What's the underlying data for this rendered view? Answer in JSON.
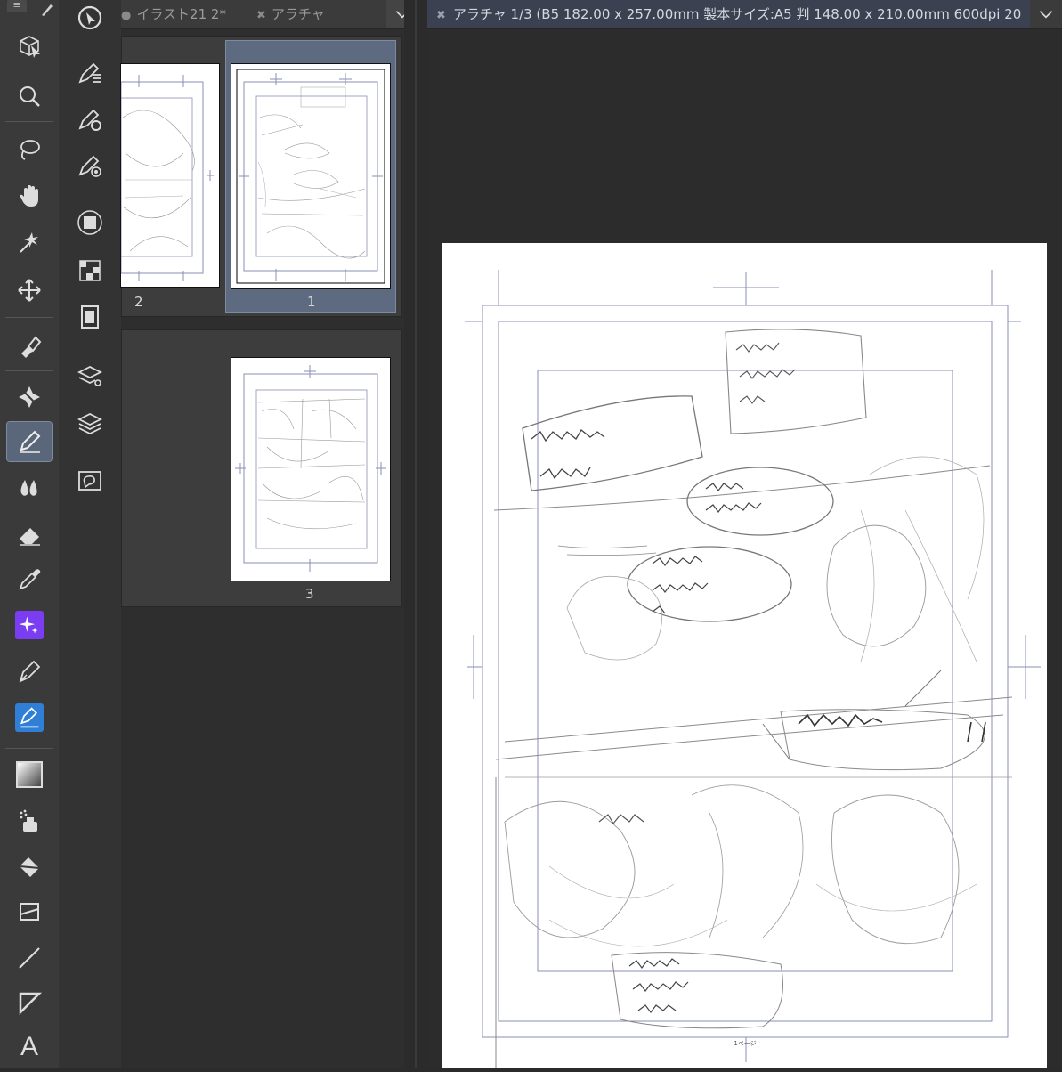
{
  "toolbar": {
    "menu_glyph": "≡",
    "tools": [
      {
        "name": "object-select-icon"
      },
      {
        "name": "zoom-icon"
      },
      {
        "name": "lasso-select-icon"
      },
      {
        "name": "hand-icon"
      },
      {
        "name": "magic-wand-icon"
      },
      {
        "name": "move-icon"
      },
      {
        "name": "eyedropper-rotate-icon"
      },
      {
        "name": "magic-wand-selection-icon"
      },
      {
        "name": "pen-icon",
        "active": true
      },
      {
        "name": "blend-icon"
      },
      {
        "name": "eraser-icon"
      },
      {
        "name": "eyedropper-icon"
      },
      {
        "name": "ai-sparkle-icon"
      },
      {
        "name": "fountain-pen-icon"
      },
      {
        "name": "fill-pen-icon"
      },
      {
        "name": "gradient-icon"
      },
      {
        "name": "airbrush-icon"
      },
      {
        "name": "paint-bucket-icon"
      },
      {
        "name": "frame-border-icon"
      },
      {
        "name": "line-icon"
      },
      {
        "name": "ruler-triangle-icon"
      },
      {
        "name": "text-icon",
        "label": "A"
      }
    ]
  },
  "subtool": {
    "items": [
      "cursor-icon",
      "layer-property-icon",
      "settings-pen-icon",
      "target-pen-icon",
      "frame-icon",
      "grid-icon",
      "film-icon",
      "layer-search-icon",
      "layers-icon",
      "comment-icon"
    ]
  },
  "tabs": {
    "left": [
      {
        "label": "イラスト21 2*",
        "dot": true
      },
      {
        "label": "アラチャ",
        "closable": true
      }
    ],
    "canvas": {
      "label": "アラチャ 1/3 (B5 182.00 x 257.00mm 製本サイズ:A5 判 148.00 x 210.00mm 600dpi 20"
    }
  },
  "pages": {
    "spread1": [
      {
        "number": "2"
      },
      {
        "number": "1",
        "selected": true
      }
    ],
    "spread2": [
      {
        "number": "3"
      }
    ]
  },
  "colors": {
    "accent_selected": "#5d6a80",
    "ai_tool": "#7b3df2",
    "fill_tool": "#2f7fd6"
  },
  "canvas": {
    "footer_text": "1ページ"
  }
}
